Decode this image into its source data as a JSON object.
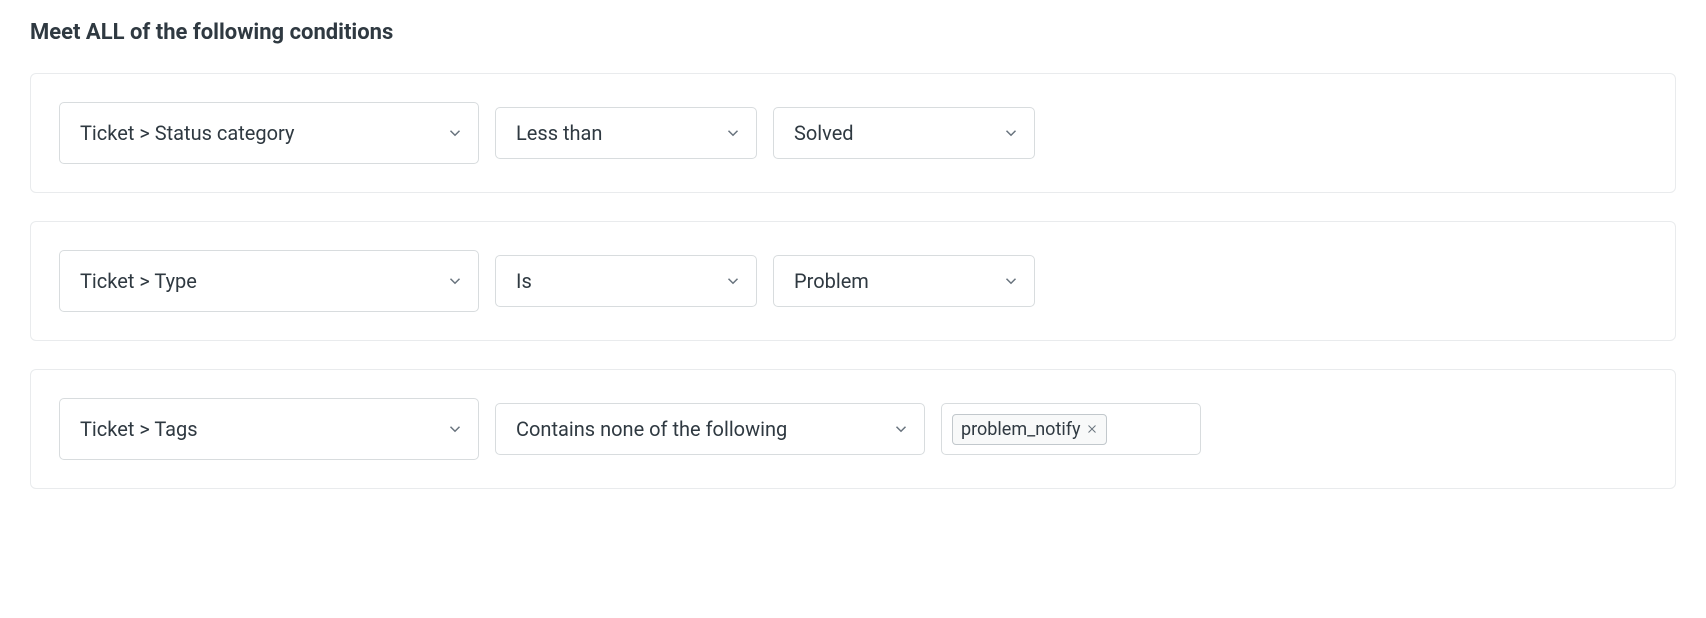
{
  "section_title": "Meet ALL of the following conditions",
  "conditions": [
    {
      "field": "Ticket > Status category",
      "operator": "Less than",
      "value": "Solved"
    },
    {
      "field": "Ticket > Type",
      "operator": "Is",
      "value": "Problem"
    },
    {
      "field": "Ticket > Tags",
      "operator": "Contains none of the following",
      "tags": [
        "problem_notify"
      ]
    }
  ]
}
